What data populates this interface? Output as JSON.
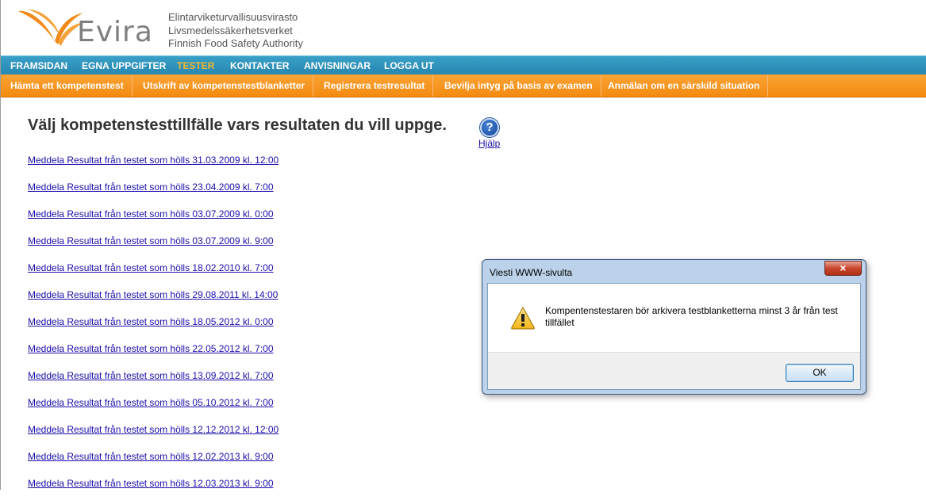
{
  "header": {
    "logo_text": "Evira",
    "agency_lines": [
      "Elintarviketurvallisuusvirasto",
      "Livsmedelssäkerhetsverket",
      "Finnish Food Safety Authority"
    ]
  },
  "topnav": {
    "items": [
      "FRAMSIDAN",
      "EGNA UPPGIFTER",
      "TESTER",
      "KONTAKTER",
      "ANVISNINGAR",
      "LOGGA UT"
    ],
    "active": "TESTER",
    "active_color": "#f7b52a"
  },
  "subnav": {
    "items": [
      "Hämta ett kompetenstest",
      "Utskrift av kompetenstestblanketter",
      "Registrera testresultat",
      "Bevilja intyg på basis av examen",
      "Anmälan om en särskild situation"
    ]
  },
  "main": {
    "title": "Välj kompetenstesttillfälle vars resultaten du vill uppge.",
    "help_label": "Hjälp",
    "help_icon": "question-mark-icon",
    "links": [
      "Meddela Resultat från testet som hölls 31.03.2009 kl. 12:00",
      "Meddela Resultat från testet som hölls 23.04.2009 kl. 7:00",
      "Meddela Resultat från testet som hölls 03.07.2009 kl. 0:00",
      "Meddela Resultat från testet som hölls 03.07.2009 kl. 9:00",
      "Meddela Resultat från testet som hölls 18.02.2010 kl. 7:00",
      "Meddela Resultat från testet som hölls 29.08.2011 kl. 14:00",
      "Meddela Resultat från testet som hölls 18.05.2012 kl. 0:00",
      "Meddela Resultat från testet som hölls 22.05.2012 kl. 7:00",
      "Meddela Resultat från testet som hölls 13.09.2012 kl. 7:00",
      "Meddela Resultat från testet som hölls 05.10.2012 kl. 7:00",
      "Meddela Resultat från testet som hölls 12.12.2012 kl. 12:00",
      "Meddela Resultat från testet som hölls 12.02.2013 kl. 9:00",
      "Meddela Resultat från testet som hölls 12.03.2013 kl. 9:00"
    ]
  },
  "dialog": {
    "title": "Viesti WWW-sivulta",
    "message": "Kompentenstestaren bör arkivera testblanketterna minst 3 år från test tillfället",
    "ok_label": "OK",
    "close_label": "×",
    "icon": "warning-icon"
  }
}
